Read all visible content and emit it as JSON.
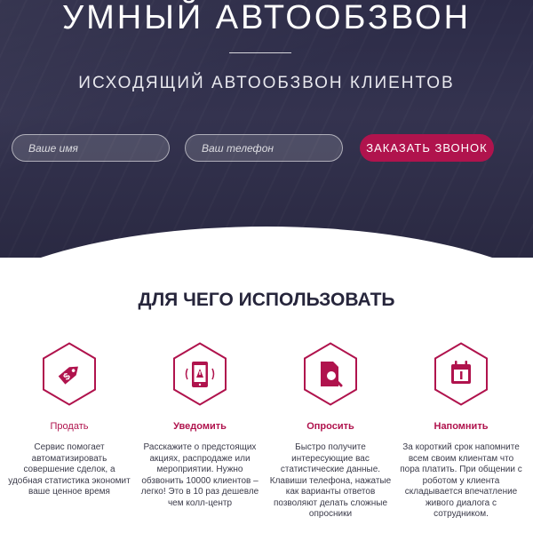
{
  "hero": {
    "title": "УМНЫЙ АВТООБЗВОН",
    "subtitle": "ИСХОДЯЩИЙ АВТООБЗВОН КЛИЕНТОВ",
    "form": {
      "name_placeholder": "Ваше имя",
      "phone_placeholder": "Ваш телефон",
      "cta_label": "ЗАКАЗАТЬ ЗВОНОК"
    }
  },
  "features": {
    "title": "ДЛЯ ЧЕГО ИСПОЛЬЗОВАТЬ",
    "items": [
      {
        "icon": "price-tag-dollar-icon",
        "label": "Продать",
        "description": "Сервис помогает автоматизировать совершение сделок, а удобная статистика экономит ваше ценное время"
      },
      {
        "icon": "phone-alert-icon",
        "label": "Уведомить",
        "description": "Расскажите о предстоящих акциях, распродаже или мероприятии. Нужно обзвонить 10000 клиентов – легко! Это в 10 раз дешевле чем колл-центр"
      },
      {
        "icon": "document-search-icon",
        "label": "Опросить",
        "description": "Быстро получите интересующие вас статистические данные. Клавиши телефона, нажатые как варианты ответов позволяют делать сложные опросники"
      },
      {
        "icon": "calendar-icon",
        "label": "Напомнить",
        "description": "За короткий срок напомните всем своим клиентам что пора платить. При общении с роботом у клиента складывается впечатление живого диалога с сотрудником."
      }
    ]
  },
  "colors": {
    "accent": "#b0134d",
    "hero_bg": "#2c2b47",
    "heading": "#26253b"
  }
}
